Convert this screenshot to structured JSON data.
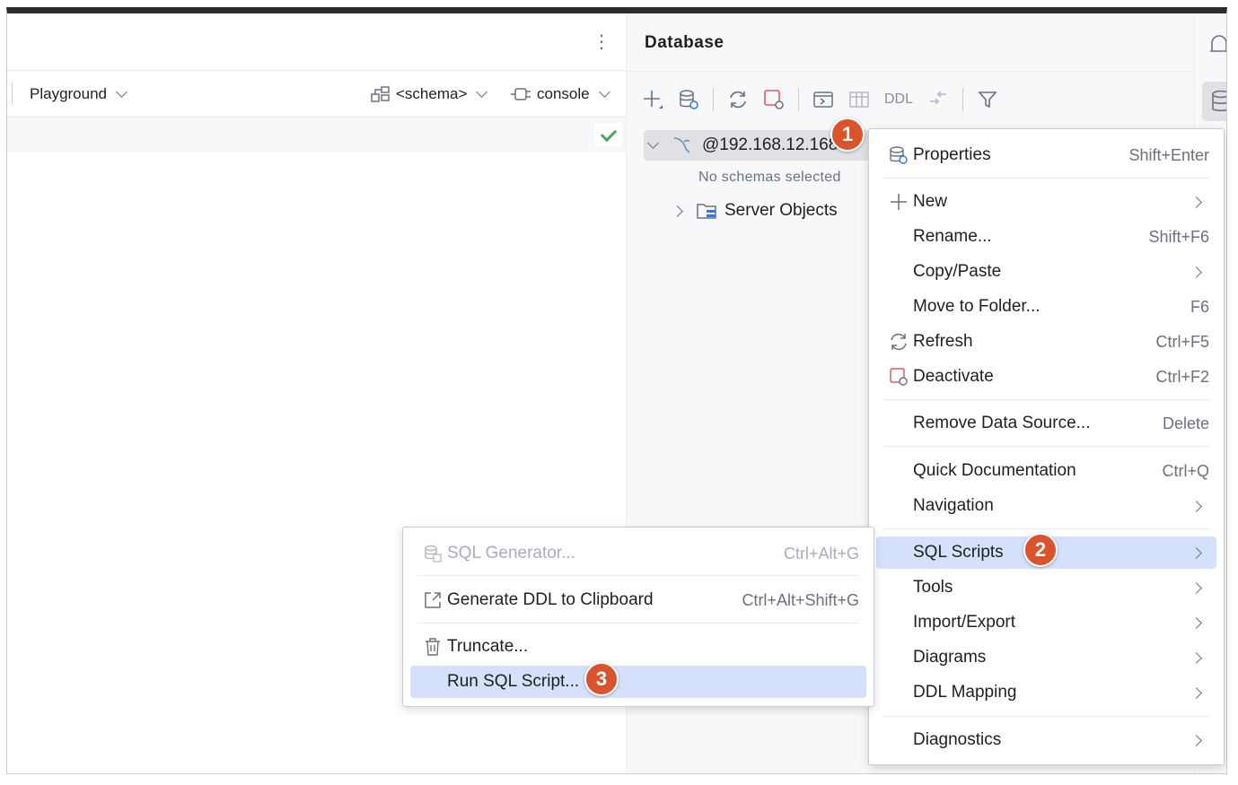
{
  "editor": {
    "toolbar": {
      "playground": "Playground",
      "schema": "<schema>",
      "console": "console"
    }
  },
  "database": {
    "title": "Database",
    "toolbar": {
      "ddl": "DDL"
    },
    "tree": {
      "connection": "@192.168.12.168",
      "no_schemas": "No schemas selected",
      "server_objects": "Server Objects"
    }
  },
  "context_menu": {
    "items": [
      {
        "label": "Properties",
        "shortcut": "Shift+Enter"
      },
      {
        "label": "New",
        "shortcut": ""
      },
      {
        "label": "Rename...",
        "shortcut": "Shift+F6"
      },
      {
        "label": "Copy/Paste",
        "shortcut": ""
      },
      {
        "label": "Move to Folder...",
        "shortcut": "F6"
      },
      {
        "label": "Refresh",
        "shortcut": "Ctrl+F5"
      },
      {
        "label": "Deactivate",
        "shortcut": "Ctrl+F2"
      },
      {
        "label": "Remove Data Source...",
        "shortcut": "Delete"
      },
      {
        "label": "Quick Documentation",
        "shortcut": "Ctrl+Q"
      },
      {
        "label": "Navigation",
        "shortcut": ""
      },
      {
        "label": "SQL Scripts",
        "shortcut": ""
      },
      {
        "label": "Tools",
        "shortcut": ""
      },
      {
        "label": "Import/Export",
        "shortcut": ""
      },
      {
        "label": "Diagrams",
        "shortcut": ""
      },
      {
        "label": "DDL Mapping",
        "shortcut": ""
      },
      {
        "label": "Diagnostics",
        "shortcut": ""
      }
    ]
  },
  "submenu": {
    "items": [
      {
        "label": "SQL Generator...",
        "shortcut": "Ctrl+Alt+G"
      },
      {
        "label": "Generate DDL to Clipboard",
        "shortcut": "Ctrl+Alt+Shift+G"
      },
      {
        "label": "Truncate...",
        "shortcut": ""
      },
      {
        "label": "Run SQL Script...",
        "shortcut": ""
      }
    ]
  },
  "badges": {
    "one": "1",
    "two": "2",
    "three": "3"
  },
  "colors": {
    "highlight": "#d5e1fb",
    "badge": "#d9532c",
    "check": "#4fa35a",
    "deactivate": "#e55765"
  }
}
